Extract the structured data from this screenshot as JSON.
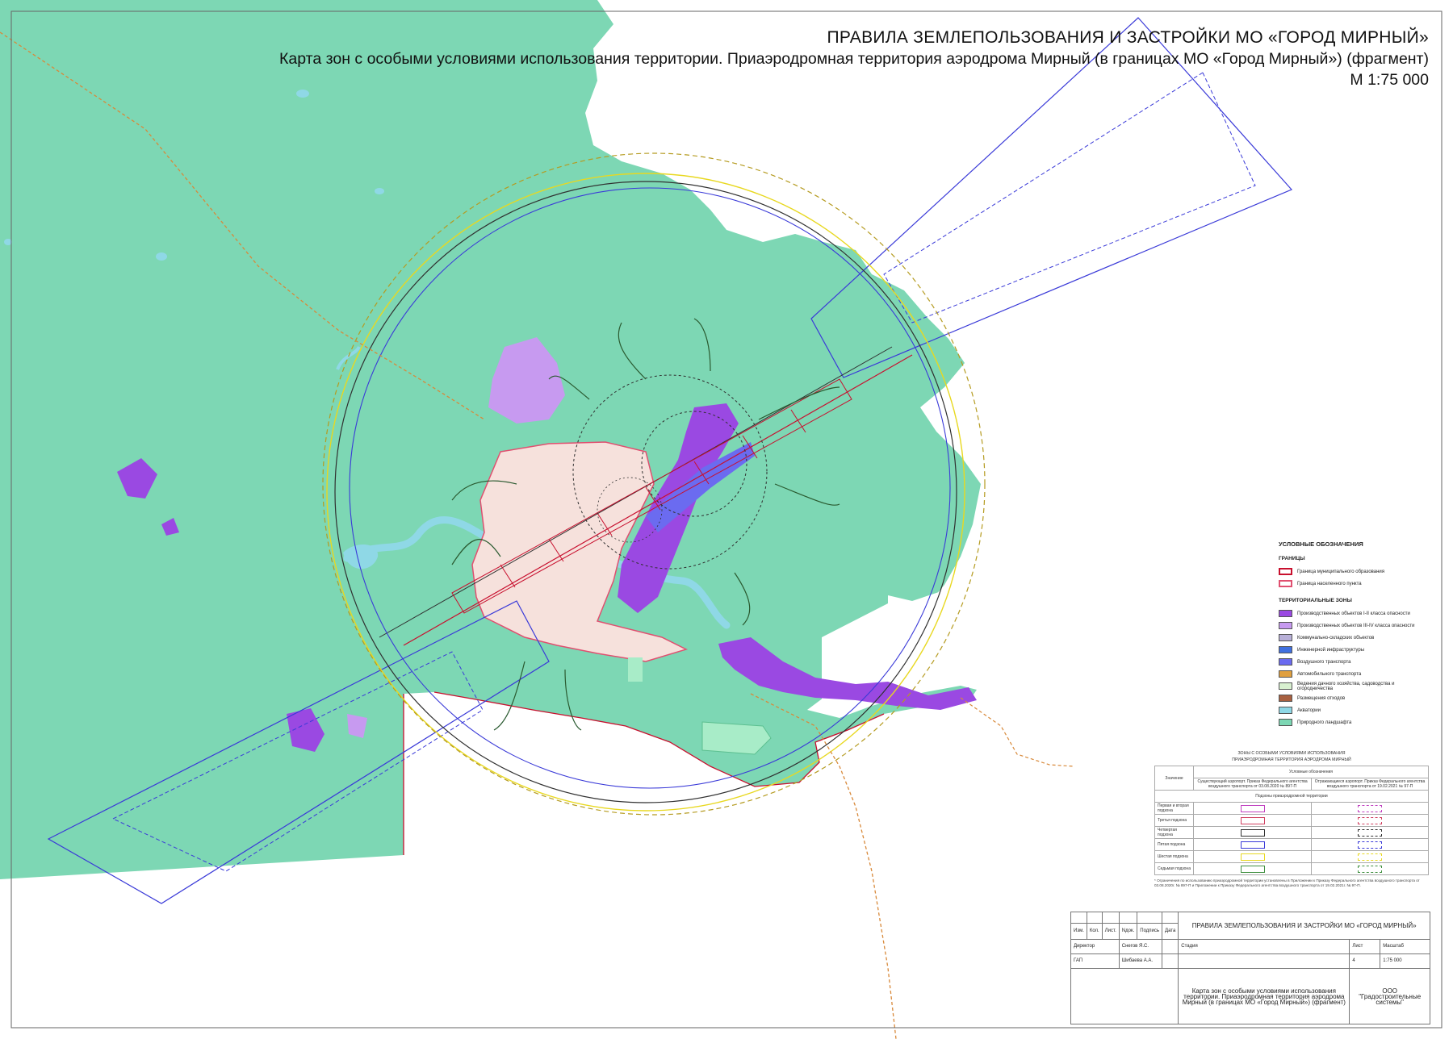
{
  "title": {
    "main": "ПРАВИЛА ЗЕМЛЕПОЛЬЗОВАНИЯ И ЗАСТРОЙКИ МО «ГОРОД МИРНЫЙ»",
    "subtitle": "Карта зон с особыми условиями использования территории. Приаэродромная территория аэродрома Мирный (в границах МО «Город Мирный») (фрагмент)",
    "scale": "М 1:75 000"
  },
  "colors": {
    "land_zone": "#7dd7b4",
    "outside": "#ffffff",
    "river": "#8fd8e6",
    "settlement": "#f6e1dc",
    "production": "#b17ae0",
    "production_dark": "#9a49e2",
    "airport": "#6b6bf0",
    "boundary_red": "#c8102e",
    "polygon_blue": "#3a3ad8",
    "circle_dark": "#303030",
    "circle_yellow": "#e8d820",
    "road": "#d8893a"
  },
  "legend": {
    "title": "УСЛОВНЫЕ ОБОЗНАЧЕНИЯ",
    "boundaries_header": "ГРАНИЦЫ",
    "boundaries": [
      {
        "label": "Граница муниципального образования",
        "color": "#c8102e"
      },
      {
        "label": "Граница населенного пункта",
        "color": "#e05070"
      }
    ],
    "zones_header": "ТЕРРИТОРИАЛЬНЫЕ ЗОНЫ",
    "zones": [
      {
        "label": "Производственных объектов I-II класса опасности",
        "color": "#9a49e2"
      },
      {
        "label": "Производственных объектов III-IV класса опасности",
        "color": "#c79af0"
      },
      {
        "label": "Коммунально-складских объектов",
        "color": "#b8b0d8"
      },
      {
        "label": "Инженерной инфраструктуры",
        "color": "#4070e0"
      },
      {
        "label": "Воздушного транспорта",
        "color": "#6b6bf0"
      },
      {
        "label": "Автомобильного транспорта",
        "color": "#e0a040"
      },
      {
        "label": "Ведения дачного хозяйства, садоводства и огородничества",
        "color": "#d8f0d0"
      },
      {
        "label": "Размещения отходов",
        "color": "#a86040"
      },
      {
        "label": "Акватории",
        "color": "#8fd8e6"
      },
      {
        "label": "Природного ландшафта",
        "color": "#7dd7b4"
      }
    ]
  },
  "zones_table": {
    "caption_line1": "ЗОНЫ С ОСОБЫМИ УСЛОВИЯМИ ИСПОЛЬЗОВАНИЯ",
    "caption_line2": "ПРИАЭРОДРОМНАЯ ТЕРРИТОРИЯ АЭРОДРОМА МИРНЫЙ",
    "header_name": "Значение",
    "header_group": "Условные обозначения",
    "header_existing": "Существующий аэропорт. Приказ Федерального агентства воздушного транспорта от 03.08.2020 № 897-П",
    "header_planned": "Отражающиеся аэропорт. Приказ Федерального агентства воздушного транспорта от 19.02.2021 № 97-П",
    "section": "Подзоны приаэродромной территории",
    "rows": [
      {
        "label": "Первая и вторая подзона",
        "color": "#c040c0"
      },
      {
        "label": "Третья подзона",
        "color": "#d04060"
      },
      {
        "label": "Четвертая подзона",
        "color": "#303030"
      },
      {
        "label": "Пятая подзона",
        "color": "#3a3ad8"
      },
      {
        "label": "Шестая подзона",
        "color": "#e8d820"
      },
      {
        "label": "Седьмая подзона",
        "color": "#409040"
      }
    ],
    "note": "* Ограничения по использованию приаэродромной территории установлены в Приложении к Приказу Федерального агентства воздушного транспорта от 03.08.2020г. № 897-П и Приложении к Приказу Федерального агентства воздушного транспорта от 19.02.2021г. № 97-П."
  },
  "stamp": {
    "headers": [
      "Изм.",
      "Кол.",
      "Лист.",
      "Nдок.",
      "Подпись",
      "Дата"
    ],
    "project": "ПРАВИЛА ЗЕМЛЕПОЛЬЗОВАНИЯ И ЗАСТРОЙКИ МО «ГОРОД МИРНЫЙ»",
    "role1": "Директор",
    "name1": "Снегов Я.С.",
    "role2": "ГАП",
    "name2": "Шибаева А.А.",
    "stage_label": "Стадия",
    "sheet_label": "Лист",
    "scale_label": "Масштаб",
    "sheet_value": "4",
    "scale_value": "1:75 000",
    "sheet_title": "Карта зон с особыми условиями использования территории. Приаэродромная территория аэродрома Мирный (в границах МО «Город Мирный») (фрагмент)",
    "org": "ООО \"Градостроительные системы\""
  }
}
